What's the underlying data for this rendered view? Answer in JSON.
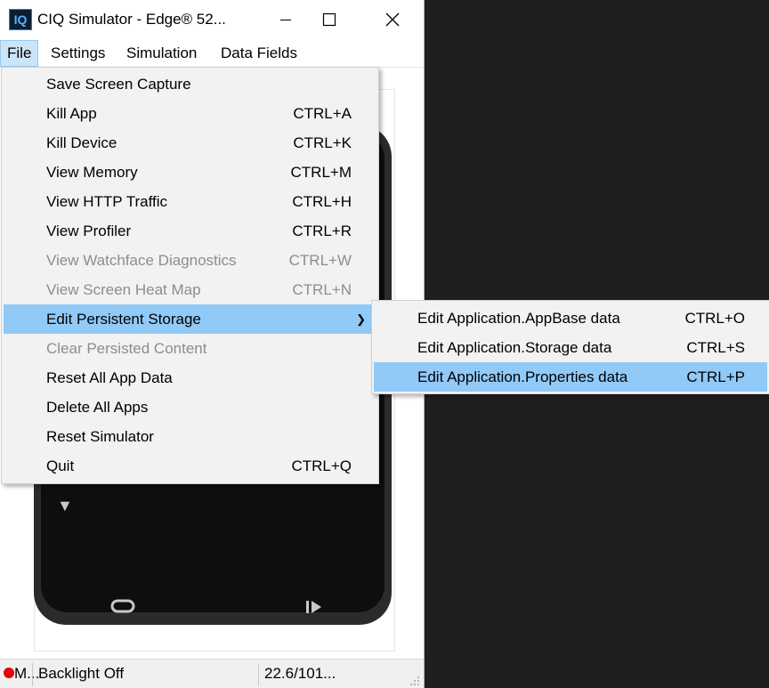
{
  "window": {
    "title": "CIQ Simulator - Edge® 52...",
    "icon_text": "IQ"
  },
  "menubar": {
    "items": [
      {
        "label": "File"
      },
      {
        "label": "Settings"
      },
      {
        "label": "Simulation"
      },
      {
        "label": "Data Fields"
      }
    ]
  },
  "file_menu": {
    "items": [
      {
        "label": "Save Screen Capture",
        "shortcut": ""
      },
      {
        "label": "Kill App",
        "shortcut": "CTRL+A"
      },
      {
        "label": "Kill Device",
        "shortcut": "CTRL+K"
      },
      {
        "label": "View Memory",
        "shortcut": "CTRL+M"
      },
      {
        "label": "View HTTP Traffic",
        "shortcut": "CTRL+H"
      },
      {
        "label": "View Profiler",
        "shortcut": "CTRL+R"
      },
      {
        "label": "View Watchface Diagnostics",
        "shortcut": "CTRL+W"
      },
      {
        "label": "View Screen Heat Map",
        "shortcut": "CTRL+N"
      },
      {
        "label": "Edit Persistent Storage",
        "shortcut": ""
      },
      {
        "label": "Clear Persisted Content",
        "shortcut": ""
      },
      {
        "label": "Reset All App Data",
        "shortcut": ""
      },
      {
        "label": "Delete All Apps",
        "shortcut": ""
      },
      {
        "label": "Reset Simulator",
        "shortcut": ""
      },
      {
        "label": "Quit",
        "shortcut": "CTRL+Q"
      }
    ]
  },
  "storage_submenu": {
    "items": [
      {
        "label": "Edit Application.AppBase data",
        "shortcut": "CTRL+O"
      },
      {
        "label": "Edit Application.Storage data",
        "shortcut": "CTRL+S"
      },
      {
        "label": "Edit Application.Properties data",
        "shortcut": "CTRL+P"
      }
    ]
  },
  "statusbar": {
    "record": "M...",
    "backlight": "Backlight Off",
    "position": "22.6/101..."
  },
  "icons": {
    "app": "connect-iq-icon",
    "minimize": "minimize-icon",
    "maximize": "maximize-icon",
    "close": "close-icon",
    "submenu": "chevron-right-icon",
    "lap": "lap-icon",
    "start_stop": "start-stop-icon",
    "down": "down-arrow-icon"
  },
  "colors": {
    "highlight": "#91c9f7",
    "menu_bg": "#f2f2f2",
    "desktop": "#1f1f1f",
    "record": "#e8000b"
  }
}
